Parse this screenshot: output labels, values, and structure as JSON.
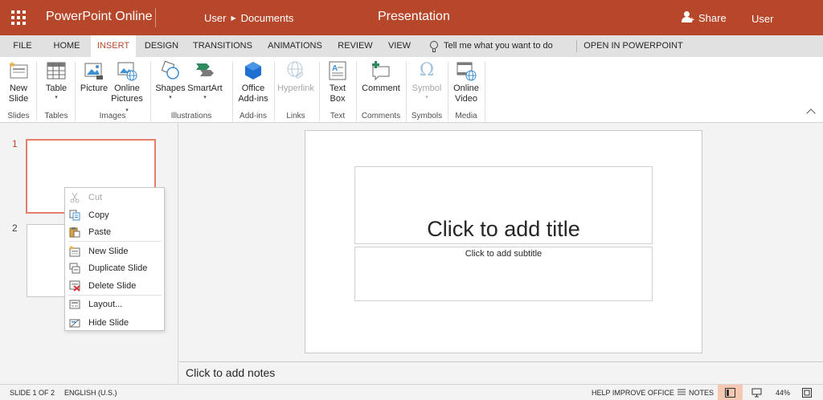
{
  "titlebar": {
    "app_name": "PowerPoint Online",
    "breadcrumb_user": "User",
    "breadcrumb_folder": "Documents",
    "doc_title": "Presentation",
    "share_label": "Share",
    "user_label": "User"
  },
  "tabs": {
    "file": "FILE",
    "home": "HOME",
    "insert": "INSERT",
    "design": "DESIGN",
    "transitions": "TRANSITIONS",
    "animations": "ANIMATIONS",
    "review": "REVIEW",
    "view": "VIEW",
    "tell_me": "Tell me what you want to do",
    "open_in_app": "OPEN IN POWERPOINT",
    "active": "INSERT"
  },
  "ribbon": {
    "new_slide_1": "New",
    "new_slide_2": "Slide",
    "table": "Table",
    "picture": "Picture",
    "online_pictures_1": "Online",
    "online_pictures_2": "Pictures",
    "shapes": "Shapes",
    "smartart": "SmartArt",
    "office_addins_1": "Office",
    "office_addins_2": "Add-ins",
    "hyperlink": "Hyperlink",
    "textbox_1": "Text",
    "textbox_2": "Box",
    "comment": "Comment",
    "symbol": "Symbol",
    "online_video_1": "Online",
    "online_video_2": "Video",
    "groups": {
      "slides": "Slides",
      "tables": "Tables",
      "images": "Images",
      "illustrations": "Illustrations",
      "addins": "Add-ins",
      "links": "Links",
      "text": "Text",
      "comments": "Comments",
      "symbols": "Symbols",
      "media": "Media"
    }
  },
  "thumbnails": {
    "slide1_num": "1",
    "slide2_num": "2"
  },
  "context_menu": {
    "cut": "Cut",
    "copy": "Copy",
    "paste": "Paste",
    "new_slide": "New Slide",
    "duplicate_slide": "Duplicate Slide",
    "delete_slide": "Delete Slide",
    "layout": "Layout...",
    "hide_slide": "Hide Slide"
  },
  "slide": {
    "title_placeholder": "Click to add title",
    "subtitle_placeholder": "Click to add subtitle"
  },
  "notes": {
    "placeholder": "Click to add notes"
  },
  "status": {
    "slide_count": "SLIDE 1 OF 2",
    "language": "ENGLISH (U.S.)",
    "help_improve": "HELP IMPROVE OFFICE",
    "notes": "NOTES",
    "zoom": "44%"
  },
  "colors": {
    "brand": "#b7472a",
    "active_tab_text": "#b7472a",
    "selected_thumb_border": "#e4806a"
  }
}
